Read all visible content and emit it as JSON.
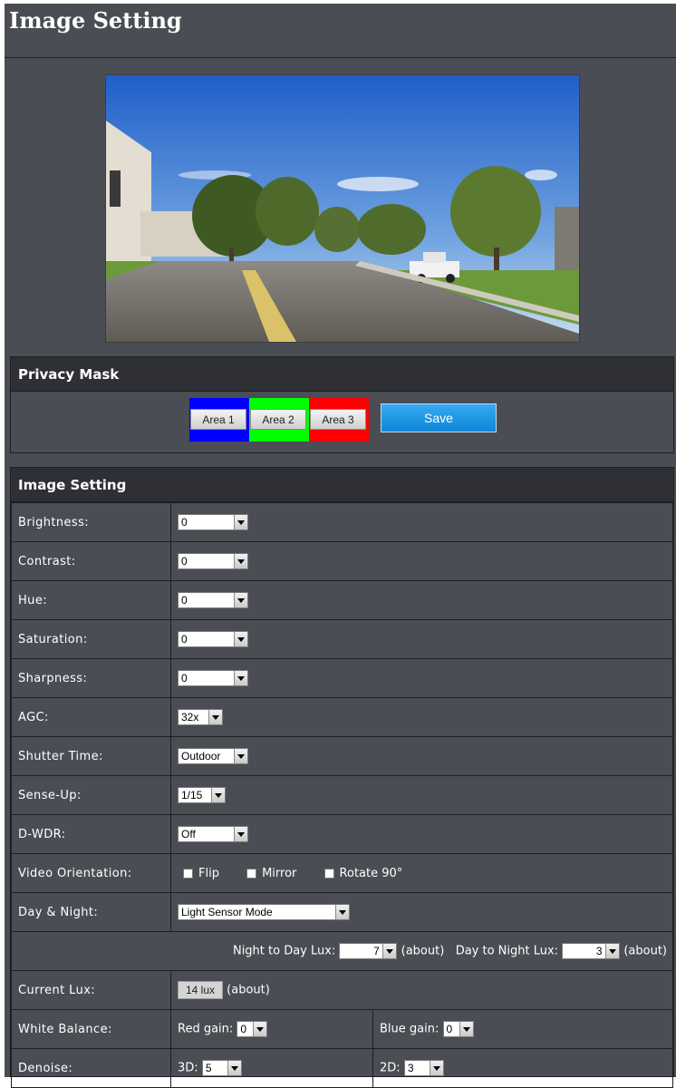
{
  "page": {
    "title": "Image Setting"
  },
  "privacy_mask": {
    "title": "Privacy Mask",
    "areas": [
      {
        "label": "Area 1",
        "color": "#0000ff"
      },
      {
        "label": "Area 2",
        "color": "#00ff00"
      },
      {
        "label": "Area 3",
        "color": "#ff0000"
      }
    ],
    "save_label": "Save"
  },
  "image_setting": {
    "title": "Image Setting",
    "brightness": {
      "label": "Brightness:",
      "value": "0"
    },
    "contrast": {
      "label": "Contrast:",
      "value": "0"
    },
    "hue": {
      "label": "Hue:",
      "value": "0"
    },
    "saturation": {
      "label": "Saturation:",
      "value": "0"
    },
    "sharpness": {
      "label": "Sharpness:",
      "value": "0"
    },
    "agc": {
      "label": "AGC:",
      "value": "32x"
    },
    "shutter_time": {
      "label": "Shutter Time:",
      "value": "Outdoor"
    },
    "sense_up": {
      "label": "Sense-Up:",
      "value": "1/15"
    },
    "dwdr": {
      "label": "D-WDR:",
      "value": "Off"
    },
    "video_orientation": {
      "label": "Video Orientation:",
      "flip": "Flip",
      "mirror": "Mirror",
      "rotate": "Rotate 90°"
    },
    "day_night": {
      "label": "Day & Night:",
      "value": "Light Sensor Mode"
    },
    "lux": {
      "n2d_label": "Night to Day Lux:",
      "n2d_value": "7 lux",
      "d2n_label": "Day to Night Lux:",
      "d2n_value": "3 lux",
      "about": "(about)"
    },
    "current_lux": {
      "label": "Current Lux:",
      "value": "14 lux",
      "about": "(about)"
    },
    "white_balance": {
      "label": "White Balance:",
      "red_label": "Red gain:",
      "red_value": "0",
      "blue_label": "Blue gain:",
      "blue_value": "0"
    },
    "denoise": {
      "label": "Denoise:",
      "d3_label": "3D:",
      "d3_value": "5",
      "d2_label": "2D:",
      "d2_value": "3"
    }
  }
}
